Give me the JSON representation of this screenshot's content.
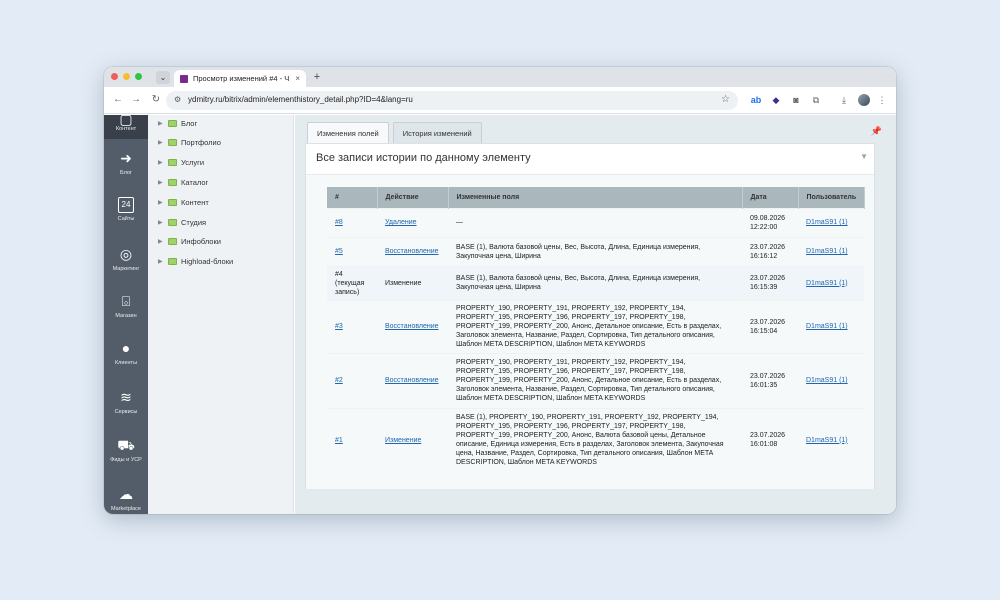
{
  "browser": {
    "tab_title": "Просмотр изменений #4 - Ч",
    "tab_close": "×",
    "new_tab": "+",
    "url": "ydmitry.ru/bitrix/admin/elementhistory_detail.php?ID=4&lang=ru",
    "extensions": [
      "ab-icon",
      "diamond-icon",
      "camera-icon",
      "puzzle-icon",
      "download-icon"
    ]
  },
  "left_panel": {
    "items": [
      {
        "label": "Контент",
        "icon": "content-icon"
      },
      {
        "label": "Блог",
        "icon": "arrow-circle-icon"
      },
      {
        "label": "Сайты",
        "icon": "calendar-icon"
      },
      {
        "label": "Маркетинг",
        "icon": "target-icon"
      },
      {
        "label": "Магазин",
        "icon": "basket-icon"
      },
      {
        "label": "Клиенты",
        "icon": "clients-icon"
      },
      {
        "label": "Сервисы",
        "icon": "layers-icon"
      },
      {
        "label": "Фиды и УСР",
        "icon": "cart-icon"
      },
      {
        "label": "Marketplace",
        "icon": "cloud-icon"
      }
    ],
    "calendar_number": "24"
  },
  "tree": {
    "items": [
      "Блог",
      "Портфолио",
      "Услуги",
      "Каталог",
      "Контент",
      "Студия",
      "Инфоблоки",
      "Highload-блоки"
    ]
  },
  "tabs": [
    "Изменения полей",
    "История изменений"
  ],
  "panel": {
    "title": "Все записи истории по данному элементу"
  },
  "table": {
    "headers": [
      "#",
      "Действие",
      "Измененные поля",
      "Дата",
      "Пользователь"
    ],
    "rows": [
      {
        "num": "#8",
        "action": "Удаление",
        "fields": "—",
        "date": "09.08.2026 12:22:00",
        "user": "D1maS91 (1)",
        "current": false
      },
      {
        "num": "#5",
        "action": "Восстановление",
        "fields": "BASE (1), Валюта базовой цены, Вес, Высота, Длина, Единица измерения, Закупочная цена, Ширина",
        "date": "23.07.2026 16:16:12",
        "user": "D1maS91 (1)",
        "current": false
      },
      {
        "num": "#4 (текущая запись)",
        "action": "Изменение",
        "fields": "BASE (1), Валюта базовой цены, Вес, Высота, Длина, Единица измерения, Закупочная цена, Ширина",
        "date": "23.07.2026 16:15:39",
        "user": "D1maS91 (1)",
        "current": true
      },
      {
        "num": "#3",
        "action": "Восстановление",
        "fields": "PROPERTY_190, PROPERTY_191, PROPERTY_192, PROPERTY_194, PROPERTY_195, PROPERTY_196, PROPERTY_197, PROPERTY_198, PROPERTY_199, PROPERTY_200, Анонс, Детальное описание, Есть в разделах, Заголовок элемента, Название, Раздел, Сортировка, Тип детального описания, Шаблон META DESCRIPTION, Шаблон META KEYWORDS",
        "date": "23.07.2026 16:15:04",
        "user": "D1maS91 (1)",
        "current": false
      },
      {
        "num": "#2",
        "action": "Восстановление",
        "fields": "PROPERTY_190, PROPERTY_191, PROPERTY_192, PROPERTY_194, PROPERTY_195, PROPERTY_196, PROPERTY_197, PROPERTY_198, PROPERTY_199, PROPERTY_200, Анонс, Детальное описание, Есть в разделах, Заголовок элемента, Название, Раздел, Сортировка, Тип детального описания, Шаблон META DESCRIPTION, Шаблон META KEYWORDS",
        "date": "23.07.2026 16:01:35",
        "user": "D1maS91 (1)",
        "current": false
      },
      {
        "num": "#1",
        "action": "Изменение",
        "fields": "BASE (1), PROPERTY_190, PROPERTY_191, PROPERTY_192, PROPERTY_194, PROPERTY_195, PROPERTY_196, PROPERTY_197, PROPERTY_198, PROPERTY_199, PROPERTY_200, Анонс, Валюта базовой цены, Детальное описание, Единица измерения, Есть в разделах, Заголовок элемента, Закупочная цена, Название, Раздел, Сортировка, Тип детального описания, Шаблон META DESCRIPTION, Шаблон META KEYWORDS",
        "date": "23.07.2026 16:01:08",
        "user": "D1maS91 (1)",
        "current": false
      }
    ]
  }
}
